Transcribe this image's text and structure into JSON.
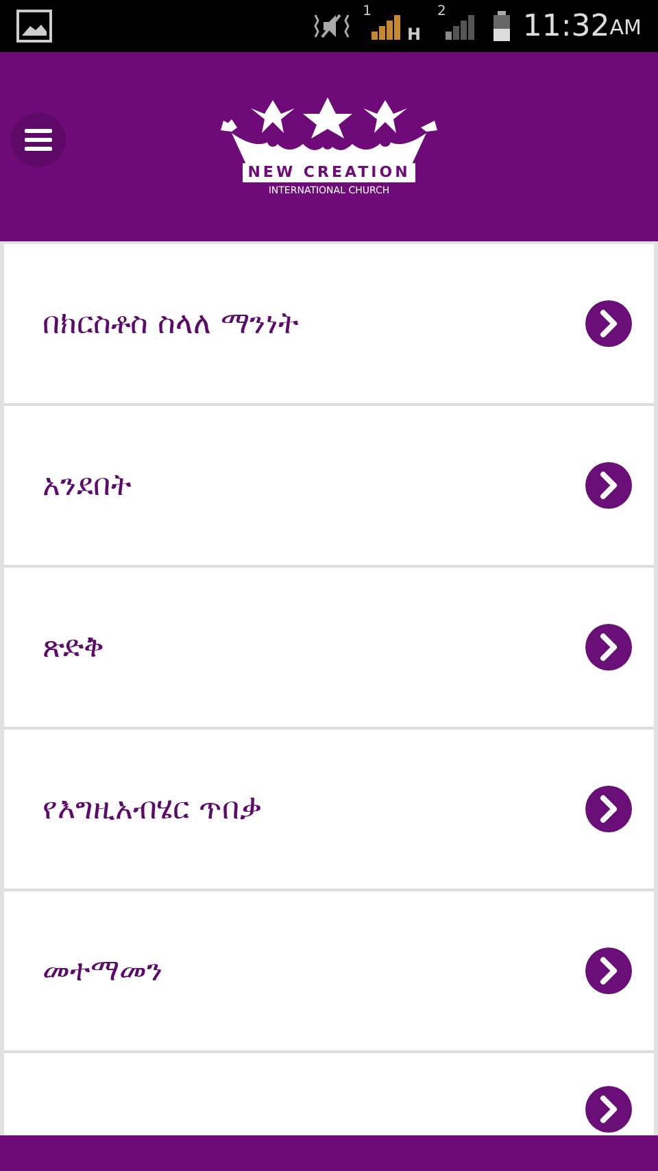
{
  "status_bar": {
    "sims": [
      {
        "label": "1"
      },
      {
        "label": "2"
      }
    ],
    "network_type": "H",
    "time": "11:32",
    "am_pm": "AM"
  },
  "header": {
    "logo": {
      "title": "NEW CREATION",
      "subtitle": "INTERNATIONAL CHURCH"
    }
  },
  "items": [
    {
      "kind": "topic",
      "label": "በክርስቶስ ስላለ ማንነት"
    },
    {
      "kind": "topic",
      "label": "አንደበት"
    },
    {
      "kind": "topic",
      "label": "ጽድቅ"
    },
    {
      "kind": "topic",
      "label": "የእግዚአብሄር ጥበቃ"
    },
    {
      "kind": "topic",
      "label": "መተማመን"
    },
    {
      "kind": "cut"
    }
  ]
}
